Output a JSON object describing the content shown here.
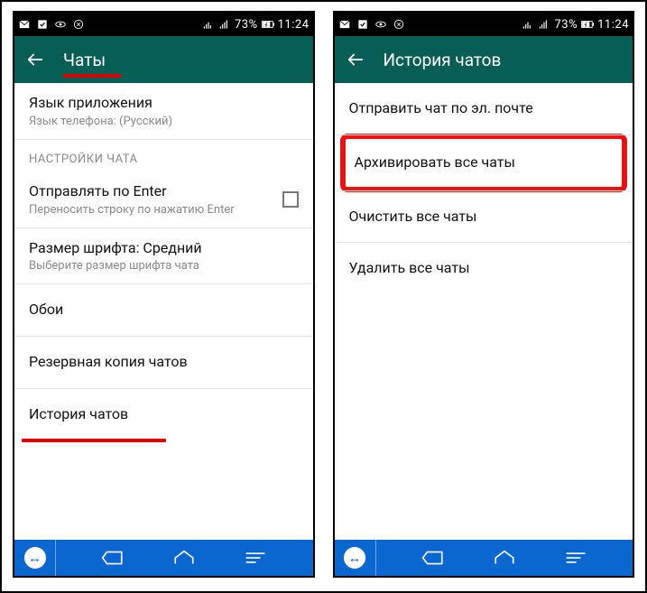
{
  "statusbar": {
    "battery_text": "73%",
    "time": "11:24"
  },
  "screen1": {
    "header_title": "Чаты",
    "lang_title": "Язык приложения",
    "lang_sub": "Язык телефона: (Русский)",
    "section_label": "НАСТРОЙКИ ЧАТА",
    "enter_title": "Отправлять по Enter",
    "enter_sub": "Переносить строку по нажатию Enter",
    "font_title": "Размер шрифта: Средний",
    "font_sub": "Выберите размер шрифта чата",
    "wallpaper": "Обои",
    "backup": "Резервная копия чатов",
    "history": "История чатов"
  },
  "screen2": {
    "header_title": "История чатов",
    "email": "Отправить чат по эл. почте",
    "archive": "Архивировать все чаты",
    "clear": "Очистить все чаты",
    "delete": "Удалить все чаты"
  }
}
